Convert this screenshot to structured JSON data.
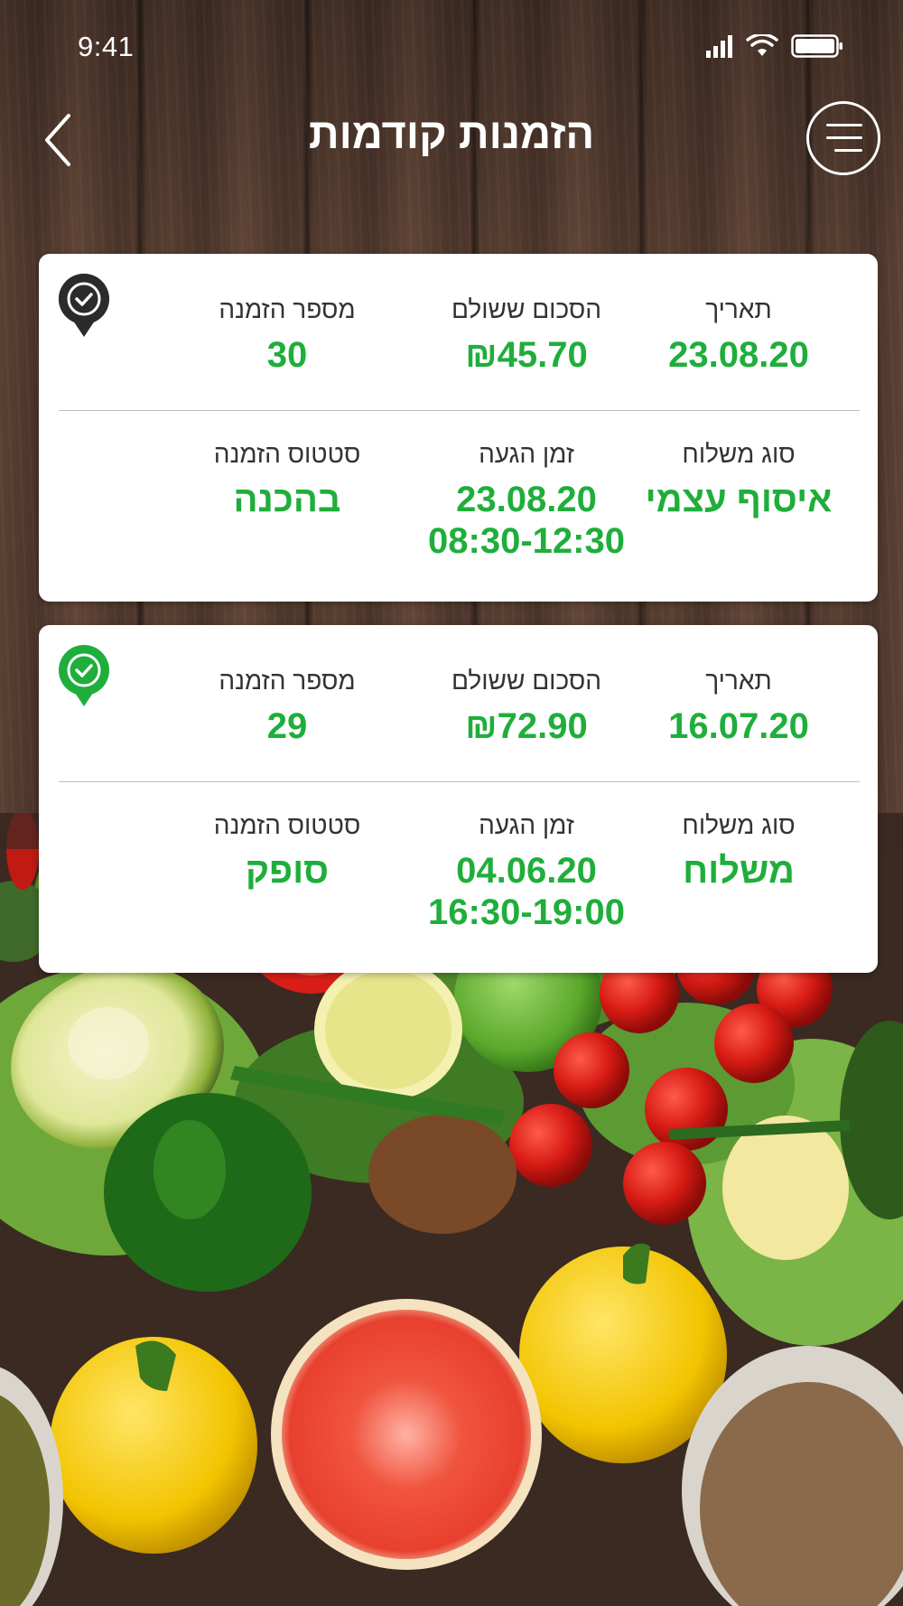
{
  "status_bar": {
    "time": "9:41",
    "signal_icon": "signal-icon",
    "wifi_icon": "wifi-icon",
    "battery_icon": "battery-icon"
  },
  "header": {
    "title": "הזמנות קודמות",
    "back_icon": "chevron-left-icon",
    "menu_icon": "hamburger-menu-icon"
  },
  "colors": {
    "accent_green": "#1fae3b",
    "icon_dark": "#2b2b2b",
    "icon_green": "#1fae3b"
  },
  "orders": [
    {
      "status_icon": "check-badge-dark-icon",
      "date_label": "תאריך",
      "date_value": "23.08.20",
      "amount_label": "הסכום ששולם",
      "amount_value": "₪45.70",
      "order_number_label": "מספר הזמנה",
      "order_number_value": "30",
      "delivery_type_label": "סוג משלוח",
      "delivery_type_value": "איסוף עצמי",
      "arrival_time_label": "זמן הגעה",
      "arrival_time_value": "23.08.20\n08:30-12:30",
      "order_status_label": "סטטוס הזמנה",
      "order_status_value": "בהכנה"
    },
    {
      "status_icon": "check-badge-green-icon",
      "date_label": "תאריך",
      "date_value": "16.07.20",
      "amount_label": "הסכום ששולם",
      "amount_value": "₪72.90",
      "order_number_label": "מספר הזמנה",
      "order_number_value": "29",
      "delivery_type_label": "סוג משלוח",
      "delivery_type_value": "משלוח",
      "arrival_time_label": "זמן הגעה",
      "arrival_time_value": "04.06.20\n16:30-19:00",
      "order_status_label": "סטטוס הזמנה",
      "order_status_value": "סופק"
    }
  ]
}
